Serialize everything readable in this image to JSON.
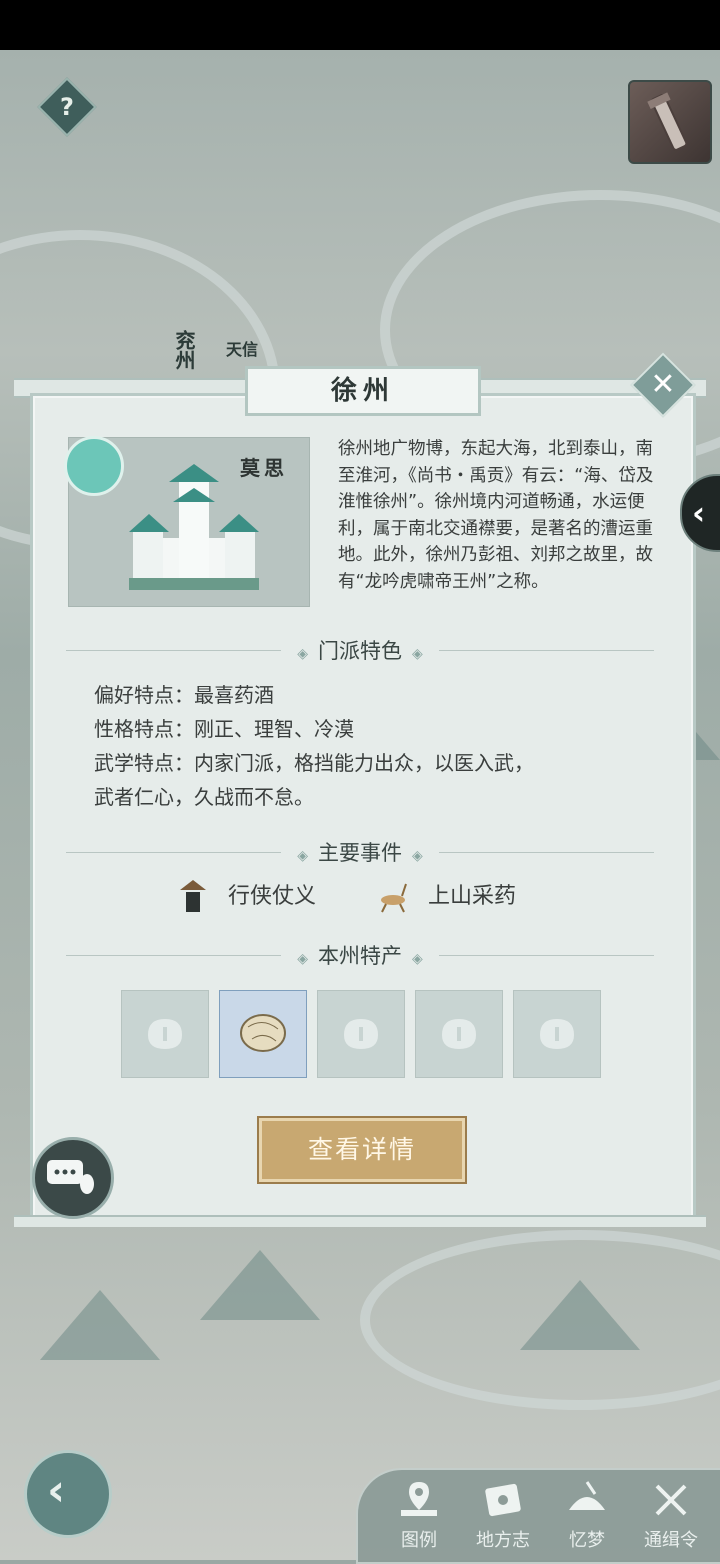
{
  "status_bar": {},
  "map": {
    "labels": [
      "兖州",
      "天信"
    ]
  },
  "panel": {
    "title": "徐州",
    "sect_name": "莫思",
    "description": "徐州地广物博，东起大海，北到泰山，南至淮河，《尚书・禹贡》有云：“海、岱及淮惟徐州”。徐州境内河道畅通，水运便利，属于南北交通襟要，是著名的漕运重地。此外，徐州乃彭祖、刘邦之故里，故有“龙吟虎啸帝王州”之称。",
    "sect_section_title": "门派特色",
    "traits": [
      "偏好特点：最喜药酒",
      "性格特点：刚正、理智、冷漠",
      "武学特点：内家门派，格挡能力出众，以医入武，",
      "武者仁心，久战而不怠。"
    ],
    "events_section_title": "主要事件",
    "events": [
      "行侠仗义",
      "上山采药"
    ],
    "products_section_title": "本州特产",
    "product_slots": [
      {
        "state": "locked"
      },
      {
        "state": "unlocked",
        "icon": "herb-bundle-icon"
      },
      {
        "state": "locked"
      },
      {
        "state": "locked"
      },
      {
        "state": "locked"
      }
    ],
    "detail_button": "查看详情"
  },
  "bottom_nav": {
    "items": [
      {
        "label": "图例",
        "icon": "legend-icon"
      },
      {
        "label": "地方志",
        "icon": "local-chronicle-icon"
      },
      {
        "label": "忆梦",
        "icon": "dream-icon"
      },
      {
        "label": "通缉令",
        "icon": "wanted-icon"
      }
    ]
  }
}
